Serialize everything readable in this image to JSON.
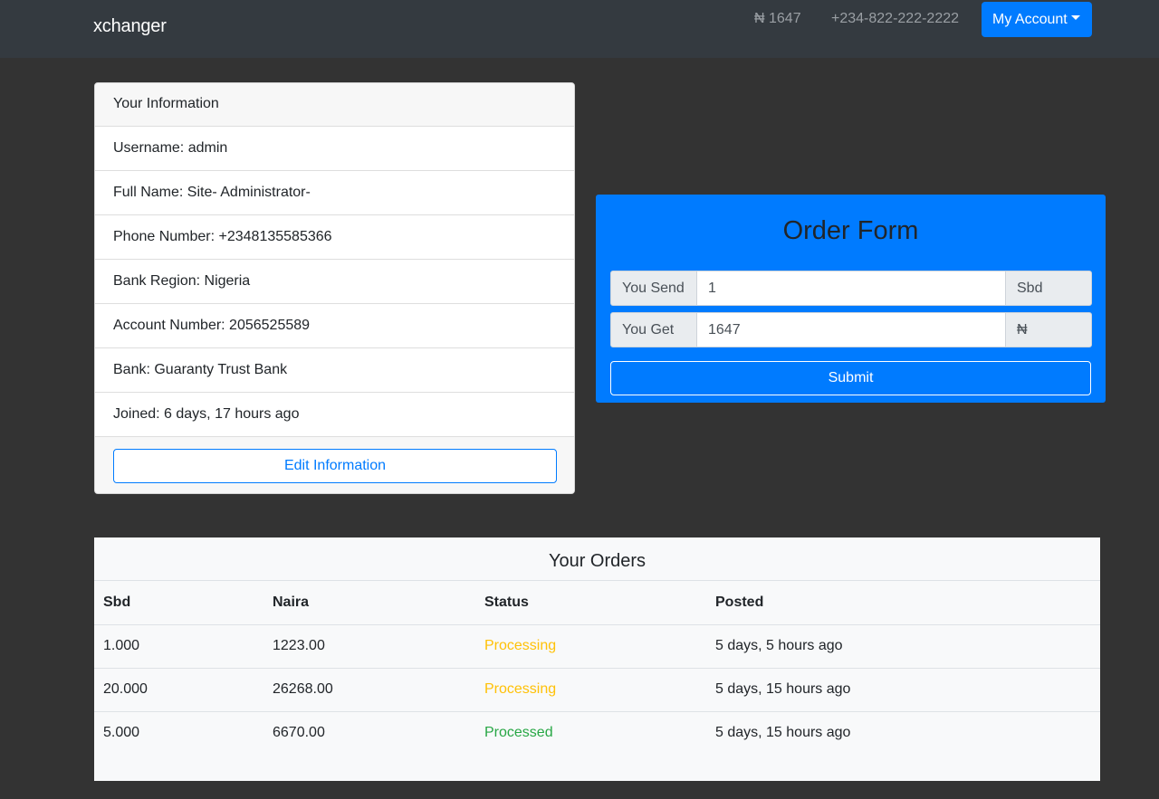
{
  "navbar": {
    "brand": "xchanger",
    "rate": "₦ 1647",
    "phone": "+234-822-222-2222",
    "account_label": "My Account"
  },
  "info": {
    "header": "Your Information",
    "rows": [
      "Username: admin",
      "Full Name: Site- Administrator-",
      "Phone Number: +2348135585366",
      "Bank Region: Nigeria",
      "Account Number: 2056525589",
      "Bank: Guaranty Trust Bank",
      "Joined: 6 days, 17 hours ago"
    ],
    "edit_label": "Edit Information"
  },
  "order_form": {
    "title": "Order Form",
    "send_label": "You Send",
    "send_value": "1",
    "send_unit": "Sbd",
    "get_label": "You Get",
    "get_value": "1647",
    "get_unit": "₦",
    "submit_label": "Submit"
  },
  "orders": {
    "title": "Your Orders",
    "columns": [
      "Sbd",
      "Naira",
      "Status",
      "Posted"
    ],
    "rows": [
      {
        "sbd": "1.000",
        "naira": "1223.00",
        "status": "Processing",
        "posted": "5 days, 5 hours ago"
      },
      {
        "sbd": "20.000",
        "naira": "26268.00",
        "status": "Processing",
        "posted": "5 days, 15 hours ago"
      },
      {
        "sbd": "5.000",
        "naira": "6670.00",
        "status": "Processed",
        "posted": "5 days, 15 hours ago"
      }
    ]
  },
  "colors": {
    "primary": "#007bff",
    "processing": "#ffc107",
    "processed": "#28a745",
    "navbar": "#343a40",
    "background": "#333333"
  }
}
